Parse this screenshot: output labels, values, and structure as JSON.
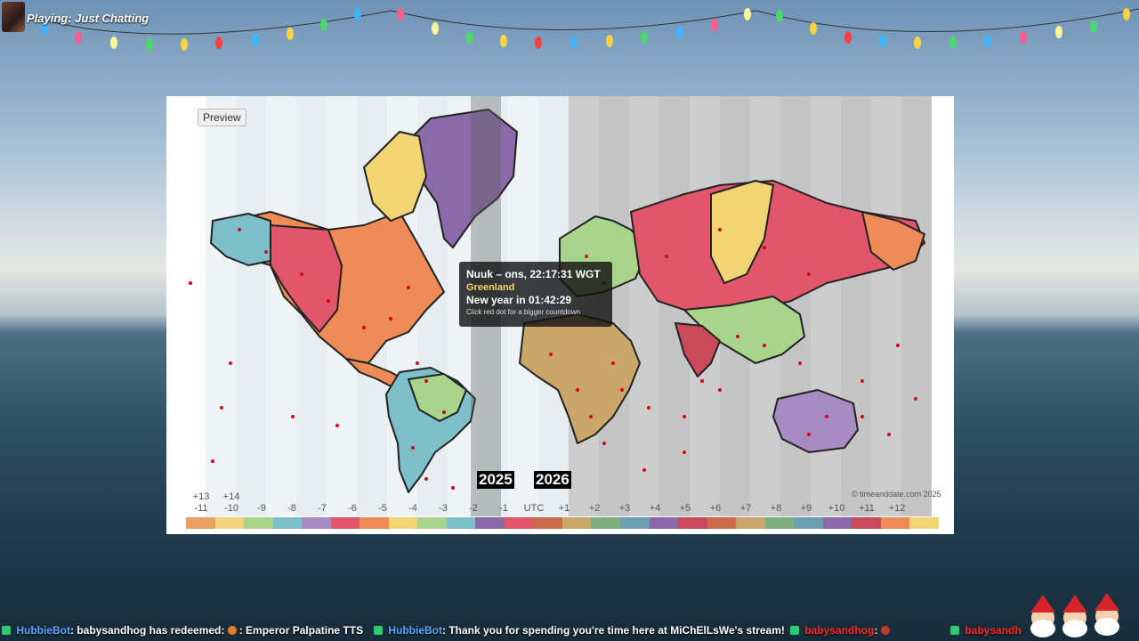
{
  "stream": {
    "game_label": "Playing: Just Chatting"
  },
  "map": {
    "preview_button": "Preview",
    "year_old": "2025",
    "year_new": "2026",
    "copyright": "© timeanddate.com 2025",
    "tooltip": {
      "title": "Nuuk – ons, 22:17:31 WGT",
      "country": "Greenland",
      "countdown": "New year in 01:42:29",
      "hint": "Click red dot for a bigger countdown"
    },
    "timezones": [
      {
        "top": "+13",
        "bottom": "-11"
      },
      {
        "top": "+14",
        "bottom": "-10"
      },
      {
        "top": "",
        "bottom": "-9"
      },
      {
        "top": "",
        "bottom": "-8"
      },
      {
        "top": "",
        "bottom": "-7"
      },
      {
        "top": "",
        "bottom": "-6"
      },
      {
        "top": "",
        "bottom": "-5"
      },
      {
        "top": "",
        "bottom": "-4"
      },
      {
        "top": "",
        "bottom": "-3"
      },
      {
        "top": "",
        "bottom": "-2"
      },
      {
        "top": "",
        "bottom": "-1"
      },
      {
        "top": "",
        "bottom": "UTC"
      },
      {
        "top": "",
        "bottom": "+1"
      },
      {
        "top": "",
        "bottom": "+2"
      },
      {
        "top": "",
        "bottom": "+3"
      },
      {
        "top": "",
        "bottom": "+4"
      },
      {
        "top": "",
        "bottom": "+5"
      },
      {
        "top": "",
        "bottom": "+6"
      },
      {
        "top": "",
        "bottom": "+7"
      },
      {
        "top": "",
        "bottom": "+8"
      },
      {
        "top": "",
        "bottom": "+9"
      },
      {
        "top": "",
        "bottom": "+10"
      },
      {
        "top": "",
        "bottom": "+11"
      },
      {
        "top": "",
        "bottom": "+12"
      }
    ],
    "strip_colors": [
      "#e8a064",
      "#f0d37a",
      "#a8d48c",
      "#7ec0c9",
      "#a98bc4",
      "#e1566a",
      "#ee8b57",
      "#f1d574",
      "#a8d48c",
      "#7ec0c9",
      "#8a6aa8",
      "#e1566a",
      "#c96a4a",
      "#c9a66a",
      "#7fae7f",
      "#6e9fb0",
      "#8a6aa8",
      "#c94a5a",
      "#c96a4a",
      "#c9a66a",
      "#7fae7f",
      "#6e9fb0",
      "#8a6aa8",
      "#c94a5a",
      "#ee8b57",
      "#f1d574"
    ]
  },
  "chat": {
    "messages": [
      {
        "user": "HubbieBot",
        "text": ": babysandhog has redeemed: ",
        "extra": ": Emperor Palpatine TTS"
      },
      {
        "user": "HubbieBot",
        "text": ": Thank you for spending you're time here at MiChElLsWe's stream!"
      },
      {
        "user": "babysandhog",
        "text": ":"
      },
      {
        "user": "babysandh",
        "text": ""
      }
    ]
  }
}
